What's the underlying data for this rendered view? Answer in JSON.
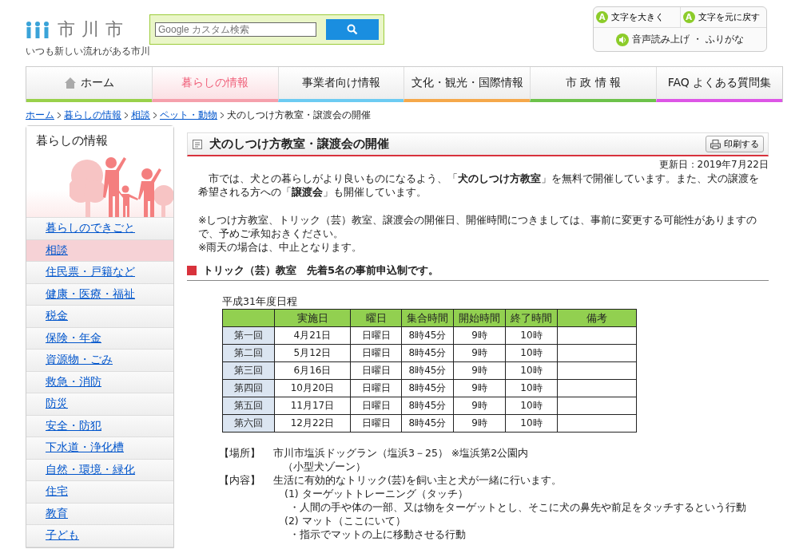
{
  "header": {
    "logo_text": "市川市",
    "tagline": "いつも新しい流れがある市川",
    "search": {
      "placeholder": "Google カスタム検索"
    },
    "tools": [
      {
        "badge": "A",
        "label": "文字を大きく"
      },
      {
        "badge": "A",
        "label": "文字を元に戻す"
      }
    ],
    "voice": "音声読み上げ ・ ふりがな"
  },
  "nav": [
    {
      "label": "ホーム",
      "kind": "home",
      "selected": false,
      "color": "#99d14a"
    },
    {
      "label": "暮らしの情報",
      "kind": "text",
      "selected": true,
      "color": "#f5a0ac"
    },
    {
      "label": "事業者向け情報",
      "kind": "text",
      "selected": false,
      "color": "#6ccbf2"
    },
    {
      "label": "文化・観光・国際情報",
      "kind": "text",
      "selected": false,
      "color": "#f5a84a"
    },
    {
      "label": "市 政 情 報",
      "kind": "text",
      "selected": false,
      "color": "#6cc24a"
    },
    {
      "label": "FAQ よくある質問集",
      "kind": "text",
      "selected": false,
      "color": "#dd55e6"
    }
  ],
  "breadcrumb": {
    "links": [
      "ホーム",
      "暮らしの情報",
      "相談",
      "ペット・動物"
    ],
    "current": "犬のしつけ方教室・譲渡会の開催"
  },
  "sidebar": {
    "title": "暮らしの情報",
    "items": [
      {
        "label": "暮らしのできごと",
        "selected": false
      },
      {
        "label": "相談",
        "selected": true
      },
      {
        "label": "住民票・戸籍など",
        "selected": false
      },
      {
        "label": "健康・医療・福祉",
        "selected": false
      },
      {
        "label": "税金",
        "selected": false
      },
      {
        "label": "保険・年金",
        "selected": false
      },
      {
        "label": "資源物・ごみ",
        "selected": false
      },
      {
        "label": "救急・消防",
        "selected": false
      },
      {
        "label": "防災",
        "selected": false
      },
      {
        "label": "安全・防犯",
        "selected": false
      },
      {
        "label": "下水道・浄化槽",
        "selected": false
      },
      {
        "label": "自然・環境・緑化",
        "selected": false
      },
      {
        "label": "住宅",
        "selected": false
      },
      {
        "label": "教育",
        "selected": false
      },
      {
        "label": "子ども",
        "selected": false
      }
    ]
  },
  "article": {
    "title": "犬のしつけ方教室・譲渡会の開催",
    "print_button": "印刷する",
    "updated": "更新日：2019年7月22日",
    "paragraphs": [
      "　市では、犬との暮らしがより良いものになるよう、「**犬のしつけ方教室**」を無料で開催しています。また、犬の譲渡を希望される方への「**譲渡会**」も開催しています。",
      "※しつけ方教室、トリック（芸）教室、譲渡会の開催日、開催時間につきましては、事前に変更する可能性がありますので、予めご承知おきください。\n※雨天の場合は、中止となります。"
    ],
    "section_heading": "トリック（芸）教室　先着5名の事前申込制です。",
    "table": {
      "caption": "平成31年度日程",
      "columns": [
        "実施日",
        "曜日",
        "集合時間",
        "開始時間",
        "終了時間",
        "備考"
      ],
      "rows": [
        {
          "label": "第一回",
          "cells": [
            "4月21日",
            "日曜日",
            "8時45分",
            "9時",
            "10時"
          ]
        },
        {
          "label": "第二回",
          "cells": [
            "5月12日",
            "日曜日",
            "8時45分",
            "9時",
            "10時"
          ]
        },
        {
          "label": "第三回",
          "cells": [
            "6月16日",
            "日曜日",
            "8時45分",
            "9時",
            "10時"
          ]
        },
        {
          "label": "第四回",
          "cells": [
            "10月20日",
            "日曜日",
            "8時45分",
            "9時",
            "10時"
          ]
        },
        {
          "label": "第五回",
          "cells": [
            "11月17日",
            "日曜日",
            "8時45分",
            "9時",
            "10時"
          ]
        },
        {
          "label": "第六回",
          "cells": [
            "12月22日",
            "日曜日",
            "8時45分",
            "9時",
            "10時"
          ]
        }
      ]
    },
    "details": [
      {
        "label": "【場所】",
        "lines": [
          {
            "kind": "main",
            "text": "市川市塩浜ドッグラン（塩浜3－25） ※塩浜第2公園内"
          },
          {
            "kind": "note",
            "text": "（小型犬ゾーン）"
          }
        ]
      },
      {
        "label": "【内容】",
        "lines": [
          {
            "kind": "main",
            "text": "生活に有効的なトリック(芸)を飼い主と犬が一緒に行います。"
          },
          {
            "kind": "item",
            "text": "(1) ターゲットトレーニング（タッチ）"
          },
          {
            "kind": "point",
            "text": "・人間の手や体の一部、又は物をターゲットとし、そこに犬の鼻先や前足をタッチするという行動"
          },
          {
            "kind": "item",
            "text": "(2) マット（ここにいて）"
          },
          {
            "kind": "point",
            "text": "・指示でマットの上に移動させる行動"
          }
        ]
      }
    ]
  }
}
